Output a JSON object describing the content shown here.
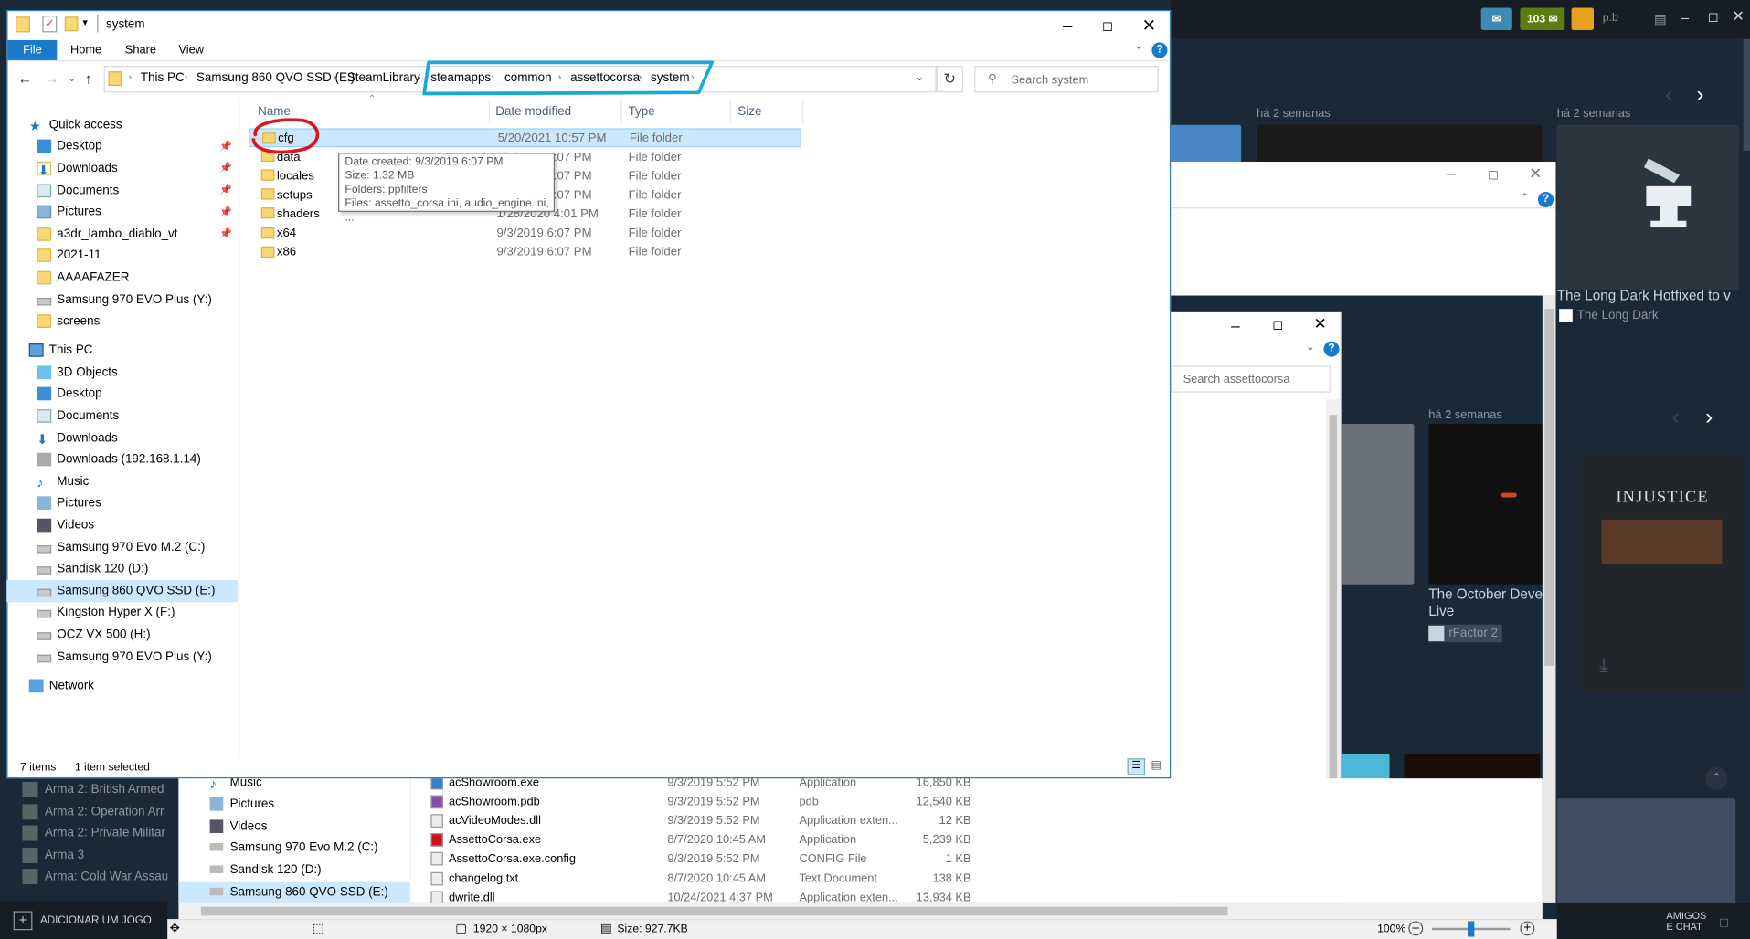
{
  "explorer": {
    "title": "system",
    "ribbon_tabs": [
      "File",
      "Home",
      "Share",
      "View"
    ],
    "breadcrumb": [
      "This PC",
      "Samsung 860 QVO SSD (E:)",
      "SteamLibrary",
      "steamapps",
      "common",
      "assettocorsa",
      "system"
    ],
    "search_placeholder": "Search system",
    "columns": {
      "name": "Name",
      "date": "Date modified",
      "type": "Type",
      "size": "Size"
    },
    "files": [
      {
        "name": "cfg",
        "date": "5/20/2021 10:57 PM",
        "type": "File folder"
      },
      {
        "name": "data",
        "date": "9/3/2019 6:07 PM",
        "type": "File folder"
      },
      {
        "name": "locales",
        "date": "9/3/2019 6:07 PM",
        "type": "File folder"
      },
      {
        "name": "setups",
        "date": "9/3/2019 6:07 PM",
        "type": "File folder"
      },
      {
        "name": "shaders",
        "date": "1/28/2020 4:01 PM",
        "type": "File folder"
      },
      {
        "name": "x64",
        "date": "9/3/2019 6:07 PM",
        "type": "File folder"
      },
      {
        "name": "x86",
        "date": "9/3/2019 6:07 PM",
        "type": "File folder"
      }
    ],
    "tooltip": {
      "created": "Date created: 9/3/2019 6:07 PM",
      "size": "Size: 1.32 MB",
      "folders": "Folders: ppfilters",
      "files": "Files: assetto_corsa.ini, audio_engine.ini, ..."
    },
    "nav": {
      "quick_access": "Quick access",
      "quick_items": [
        "Desktop",
        "Downloads",
        "Documents",
        "Pictures",
        "a3dr_lambo_diablo_vt",
        "2021-11",
        "AAAAFAZER",
        "Samsung 970 EVO Plus  (Y:)",
        "screens"
      ],
      "this_pc": "This PC",
      "pc_items": [
        "3D Objects",
        "Desktop",
        "Documents",
        "Downloads",
        "Downloads (192.168.1.14)",
        "Music",
        "Pictures",
        "Videos",
        "Samsung 970 Evo M.2 (C:)",
        "Sandisk 120 (D:)",
        "Samsung 860 QVO SSD (E:)",
        "Kingston Hyper X (F:)",
        "OCZ VX 500 (H:)",
        "Samsung 970 EVO Plus  (Y:)"
      ],
      "network": "Network"
    },
    "status": {
      "count": "7 items",
      "selected": "1 item selected"
    }
  },
  "explorer2": {
    "search_placeholder": "Search assettocorsa",
    "nav_items": [
      "Music",
      "Pictures",
      "Videos",
      "Samsung 970 Evo M.2 (C:)",
      "Sandisk 120 (D:)",
      "Samsung 860 QVO SSD (E:)"
    ],
    "files": [
      {
        "name": "acShowroom.exe",
        "date": "9/3/2019 5:52 PM",
        "type": "Application",
        "size": "16,850 KB"
      },
      {
        "name": "acShowroom.pdb",
        "date": "9/3/2019 5:52 PM",
        "type": "pdb",
        "size": "12,540 KB"
      },
      {
        "name": "acVideoModes.dll",
        "date": "9/3/2019 5:52 PM",
        "type": "Application exten...",
        "size": "12 KB"
      },
      {
        "name": "AssettoCorsa.exe",
        "date": "8/7/2020 10:45 AM",
        "type": "Application",
        "size": "5,239 KB"
      },
      {
        "name": "AssettoCorsa.exe.config",
        "date": "9/3/2019 5:52 PM",
        "type": "CONFIG File",
        "size": "1 KB"
      },
      {
        "name": "changelog.txt",
        "date": "8/7/2020 10:45 AM",
        "type": "Text Document",
        "size": "138 KB"
      },
      {
        "name": "dwrite.dll",
        "date": "10/24/2021 4:37 PM",
        "type": "Application exten...",
        "size": "13,934 KB"
      }
    ]
  },
  "viewer": {
    "dimensions": "1920 × 1080px",
    "filesize": "Size: 927.7KB",
    "zoom": "100%"
  },
  "steam": {
    "badge_count": "103",
    "user": "p.b",
    "dates": [
      "há 2 semanas",
      "há 2 semanas",
      "há 2 semanas"
    ],
    "news1_title": "The Long Dark Hotfixed to v",
    "news1_game": "The Long Dark",
    "news2_title_1": "The October Deve",
    "news2_title_2": "Live",
    "news2_game": "rFactor 2",
    "featured_game": "INJUSTICE",
    "library": [
      "Arma 2: British Armed",
      "Arma 2: Operation Arr",
      "Arma 2: Private Militar",
      "Arma 3",
      "Arma: Cold War Assau"
    ],
    "add_game": "ADICIONAR UM JOGO",
    "friends_1": "AMIGOS",
    "friends_2": "E CHAT"
  }
}
